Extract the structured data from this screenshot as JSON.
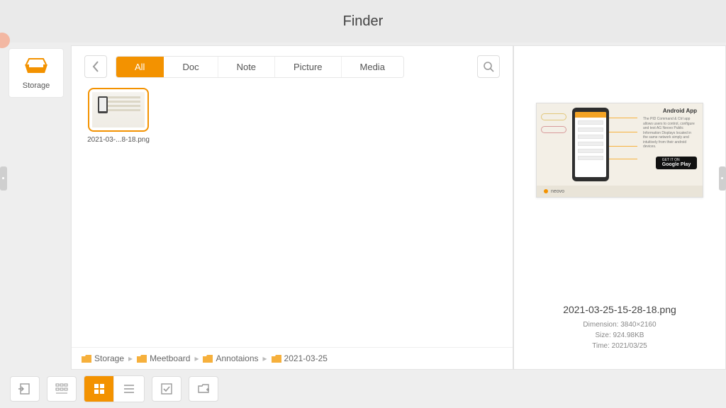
{
  "header": {
    "title": "Finder"
  },
  "sidebar": {
    "storage_label": "Storage"
  },
  "tabs": {
    "items": [
      "All",
      "Doc",
      "Note",
      "Picture",
      "Media"
    ],
    "active_index": 0
  },
  "files": [
    {
      "name_display": "2021-03-...8-18.png",
      "selected": true
    }
  ],
  "breadcrumb": [
    "Storage",
    "Meetboard",
    "Annotaions",
    "2021-03-25"
  ],
  "preview": {
    "promo_title": "Android App",
    "promo_copy": "The PID Command & Ctrl app allows users to control, configure and test AG Neovo Public Information Displays located in the same network simply and intuitively from their android devices.",
    "badge_line1": "GET IT ON",
    "badge_line2": "Google Play",
    "brand": "neovo",
    "filename": "2021-03-25-15-28-18.png",
    "dimension_label": "Dimension: 3840×2160",
    "size_label": "Size: 924.98KB",
    "time_label": "Time: 2021/03/25"
  },
  "colors": {
    "accent": "#f39200"
  }
}
